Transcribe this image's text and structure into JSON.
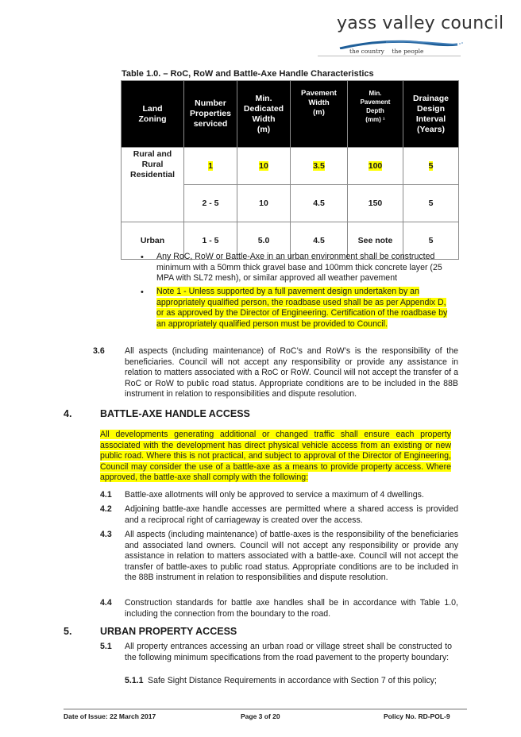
{
  "header": {
    "logo_name": "yass valley council",
    "logo_tagline_left": "the country",
    "logo_tagline_right": "the people",
    "brand_color": "#1f5f99"
  },
  "table": {
    "caption": "Table 1.0. – RoC, RoW and Battle-Axe Handle Characteristics",
    "headers": [
      "Land Zoning",
      "Number Properties serviced",
      "Min. Dedicated Width (m)",
      "Pavement Width (m)",
      "Min. Pavement Depth (mm) ¹",
      "Drainage Design Interval (Years)"
    ],
    "header_lines": [
      [
        "Land",
        "Zoning"
      ],
      [
        "Number",
        "Properties",
        "serviced"
      ],
      [
        "Min.",
        "Dedicated",
        "Width",
        "(m)"
      ],
      [
        "Pavement",
        "Width",
        "(m)"
      ],
      [
        "Min.",
        "Pavement",
        "Depth",
        "(mm) ¹"
      ],
      [
        "Drainage",
        "Design",
        "Interval",
        "(Years)"
      ]
    ],
    "rural_zone": [
      "Rural and",
      "Rural",
      "Residential"
    ],
    "rows": [
      {
        "zone": "Rural and Rural Residential",
        "properties": "1",
        "dedicated_width": "10",
        "pavement_width": "3.5",
        "pavement_depth": "100",
        "drainage": "5",
        "highlighted": true
      },
      {
        "zone": "",
        "properties": "2 - 5",
        "dedicated_width": "10",
        "pavement_width": "4.5",
        "pavement_depth": "150",
        "drainage": "5",
        "highlighted": false
      },
      {
        "zone": "Urban",
        "properties": "1 - 5",
        "dedicated_width": "5.0",
        "pavement_width": "4.5",
        "pavement_depth": "See note",
        "drainage": "5",
        "highlighted": false
      }
    ]
  },
  "bullets": [
    {
      "text": "Any RoC, RoW or Battle-Axe in an urban environment shall be constructed minimum with a 50mm thick gravel base and 100mm thick concrete layer (25 MPA with SL72 mesh), or similar approved all weather pavement",
      "highlighted": false
    },
    {
      "text": "Note 1 -  Unless supported by a full pavement design undertaken by an appropriately qualified person, the roadbase used shall be as per Appendix D, or as approved by the Director of Engineering. Certification of the roadbase by an appropriately qualified person must be provided to Council.",
      "highlighted": true
    }
  ],
  "clause_3_6": {
    "number": "3.6",
    "text": "All aspects (including maintenance) of RoC’s and RoW’s is the responsibility of the beneficiaries. Council will not accept any responsibility or provide any assistance in relation to matters associated with a RoC or RoW. Council will not accept the transfer of a RoC or RoW to public road status.  Appropriate conditions are to be included in the 88B instrument in relation to responsibilities and dispute resolution."
  },
  "section4": {
    "number": "4.",
    "title": "BATTLE-AXE HANDLE ACCESS",
    "intro": "All developments generating additional or changed traffic shall ensure each property associated with the development has direct physical vehicle access from an existing or new public road. Where this is not practical, and subject to approval of the Director of Engineering, Council may consider the use of a battle-axe as a means to provide property access. Where approved, the battle-axe shall comply with the following:",
    "clauses": [
      {
        "number": "4.1",
        "text": "Battle-axe allotments will only be approved to service a maximum of 4 dwellings."
      },
      {
        "number": "4.2",
        "text": "Adjoining battle-axe handle accesses are permitted where a shared access is provided and a reciprocal right of carriageway is created over the access."
      },
      {
        "number": "4.3",
        "text": "All aspects (including maintenance) of battle-axes is the responsibility of the beneficiaries and associated land owners. Council will not accept any responsibility or provide any assistance in relation to matters associated with a battle-axe.  Council will not accept the transfer of battle-axes to public road status.  Appropriate conditions are to be included in the 88B instrument in relation to responsibilities and dispute resolution."
      },
      {
        "number": "4.4",
        "text": "Construction standards for battle axe handles shall be in accordance with Table 1.0, including the connection from the boundary to the road."
      }
    ]
  },
  "section5": {
    "number": "5.",
    "title": "URBAN PROPERTY ACCESS",
    "clauses": [
      {
        "number": "5.1",
        "text": "All property entrances accessing an urban road or village street shall be constructed to the following minimum specifications from the road pavement to the property boundary:"
      }
    ],
    "subclauses": [
      {
        "number": "5.1.1",
        "text": "Safe Sight Distance Requirements in accordance with Section 7 of this policy;"
      }
    ]
  },
  "footer": {
    "date_of_issue": "Date of Issue:  22 March 2017",
    "page": "Page 3 of 20",
    "policy_no": "Policy No.  RD-POL-9"
  }
}
